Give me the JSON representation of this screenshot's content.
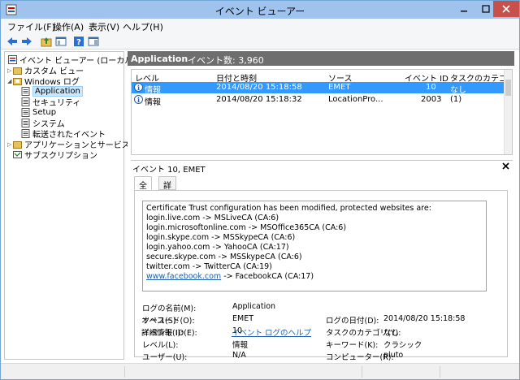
{
  "window": {
    "title": "イベント ビューアー"
  },
  "menu": [
    "ファイル(F)",
    "操作(A)",
    "表示(V)",
    "ヘルプ(H)"
  ],
  "tree": {
    "root": "イベント ビューアー (ローカル)",
    "custom_views": "カスタム ビュー",
    "windows_logs": "Windows ログ",
    "logs": [
      "Application",
      "セキュリティ",
      "Setup",
      "システム",
      "転送されたイベント"
    ],
    "apps_services": "アプリケーションとサービス ログ",
    "subscriptions": "サブスクリプション"
  },
  "header": {
    "title": "Application",
    "count": "イベント数: 3,960"
  },
  "columns": [
    "レベル",
    "日付と時刻",
    "ソース",
    "イベント ID",
    "タスクのカテゴリ"
  ],
  "rows": [
    {
      "level": "情報",
      "datetime": "2014/08/20 15:18:58",
      "source": "EMET",
      "id": "10",
      "category": "なし"
    },
    {
      "level": "情報",
      "datetime": "2014/08/20 15:18:32",
      "source": "LocationPro...",
      "id": "2003",
      "category": "(1)"
    }
  ],
  "detail": {
    "title": "イベント 10, EMET",
    "tabs": [
      "全般",
      "詳細"
    ],
    "message": [
      "Certificate Trust configuration has been modified, protected websites are:",
      "login.live.com -> MSLiveCA (CA:6)",
      "login.microsoftonline.com -> MSOffice365CA (CA:6)",
      "login.skype.com -> MSSkypeCA (CA:6)",
      "login.yahoo.com -> YahooCA (CA:17)",
      "secure.skype.com -> MSSkypeCA (CA:6)",
      "twitter.com -> TwitterCA (CA:19)"
    ],
    "message_link": "www.facebook.com",
    "message_link_rest": " -> FacebookCA (CA:17)",
    "labels": {
      "log_name": "ログの名前(M):",
      "source": "ソース(S):",
      "event_id": "イベント ID(E):",
      "level": "レベル(L):",
      "user": "ユーザー(U):",
      "opcode": "オペコード(O):",
      "more_info": "詳細情報(I):",
      "logged": "ログの日付(D):",
      "task_category": "タスクのカテゴリ(Y):",
      "keywords": "キーワード(K):",
      "computer": "コンピューター(R):"
    },
    "values": {
      "log_name": "Application",
      "source": "EMET",
      "event_id": "10",
      "level": "情報",
      "user": "N/A",
      "more_info_link": "イベント ログのヘルプ",
      "logged": "2014/08/20 15:18:58",
      "task_category": "なし",
      "keywords": "クラシック",
      "computer": "pluto"
    }
  },
  "colors": {
    "selection": "#3399ff",
    "header_bg": "#6e6e6e",
    "titlebar": "#9fc3ec",
    "close": "#c7504a"
  }
}
